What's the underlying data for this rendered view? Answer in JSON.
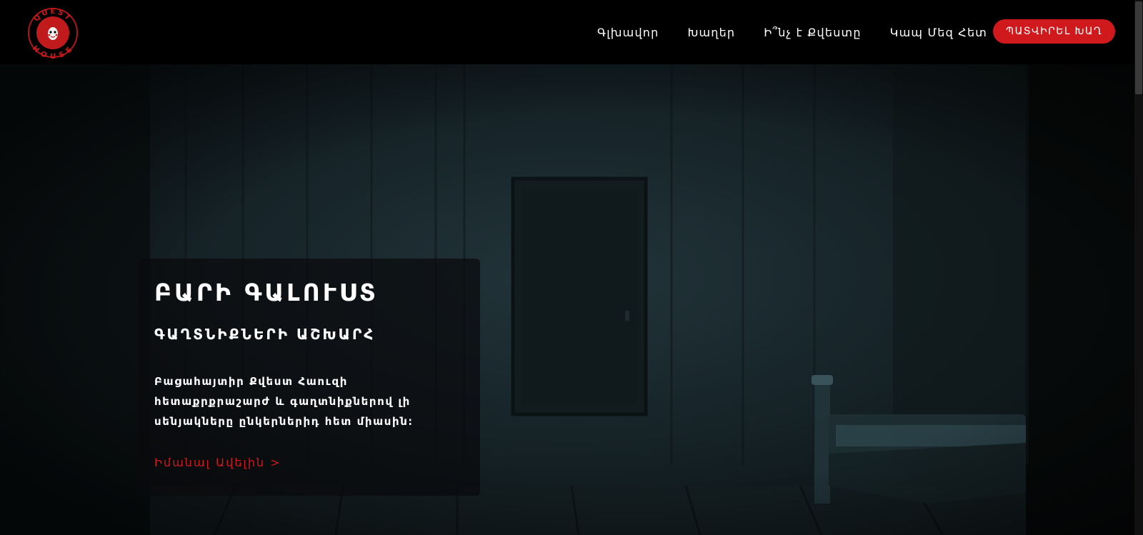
{
  "header": {
    "logo_text_top": "QUEST",
    "logo_text_bottom": "HOUSE",
    "nav": [
      {
        "label": "Գլխավոր"
      },
      {
        "label": "Խաղեր"
      },
      {
        "label": "Ի՞նչ է Քվեստը"
      },
      {
        "label": "Կապ Մեզ Հետ"
      }
    ],
    "book_button": "ՊԱՏՎԻՐԵԼ ԽԱՂ"
  },
  "hero": {
    "title": "ԲԱՐԻ ԳԱԼՈՒՍՏ",
    "subtitle": "ԳԱՂՏՆԻՔՆԵՐԻ ԱՇԽԱՐՀ",
    "description": "Բացահայտիր Քվեստ Հաուզի հետաքրքրաշարժ և գաղտնիքներով լի սենյակները ընկերներիդ հետ միասին։",
    "link": "Իմանալ Ավելին >"
  },
  "colors": {
    "accent": "#d0191c",
    "header_bg": "#000000",
    "hero_bg": "#17252a"
  }
}
